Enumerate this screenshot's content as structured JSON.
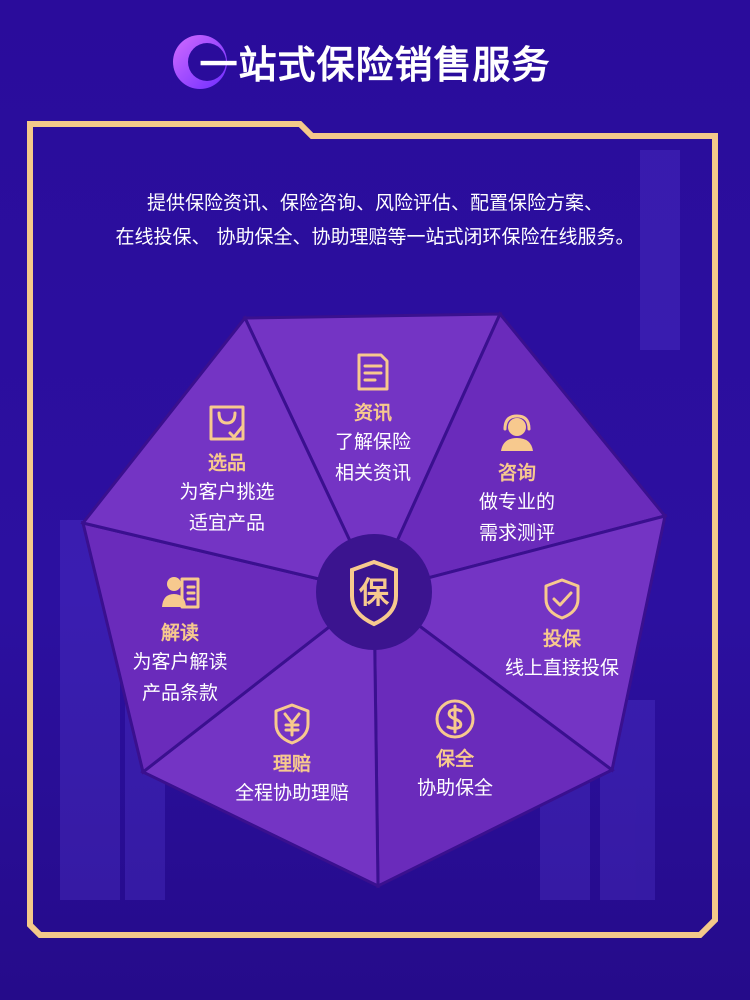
{
  "title": "一站式保险销售服务",
  "intro": {
    "line1": "提供保险资讯、保险咨询、风险评估、配置保险方案、",
    "line2": "在线投保、 协助保全、协助理赔等一站式闭环保险在线服务。"
  },
  "center": {
    "label": "保"
  },
  "colors": {
    "background": "#2c0f9e",
    "frame": "#f4c98a",
    "segment": "#7434c4",
    "segment_alt": "#6a2bbb",
    "divider": "#3a108f",
    "hub": "#3b148f",
    "accent_text": "#f7c98e"
  },
  "segments": [
    {
      "id": "zixun",
      "icon": "document-icon",
      "title": "资讯",
      "lines": [
        "了解保险",
        "相关资讯"
      ]
    },
    {
      "id": "zixun2",
      "icon": "customer-service-icon",
      "title": "咨询",
      "lines": [
        "做专业的",
        "需求测评"
      ]
    },
    {
      "id": "toubao",
      "icon": "shield-check-icon",
      "title": "投保",
      "lines": [
        "线上直接投保"
      ]
    },
    {
      "id": "baoquan",
      "icon": "dollar-coin-icon",
      "title": "保全",
      "lines": [
        "协助保全"
      ]
    },
    {
      "id": "lipei",
      "icon": "yen-shield-icon",
      "title": "理赔",
      "lines": [
        "全程协助理赔"
      ]
    },
    {
      "id": "jiedu",
      "icon": "user-card-icon",
      "title": "解读",
      "lines": [
        "为客户解读",
        "产品条款"
      ]
    },
    {
      "id": "xuanpin",
      "icon": "shopping-bag-icon",
      "title": "选品",
      "lines": [
        "为客户挑选",
        "适宜产品"
      ]
    }
  ]
}
